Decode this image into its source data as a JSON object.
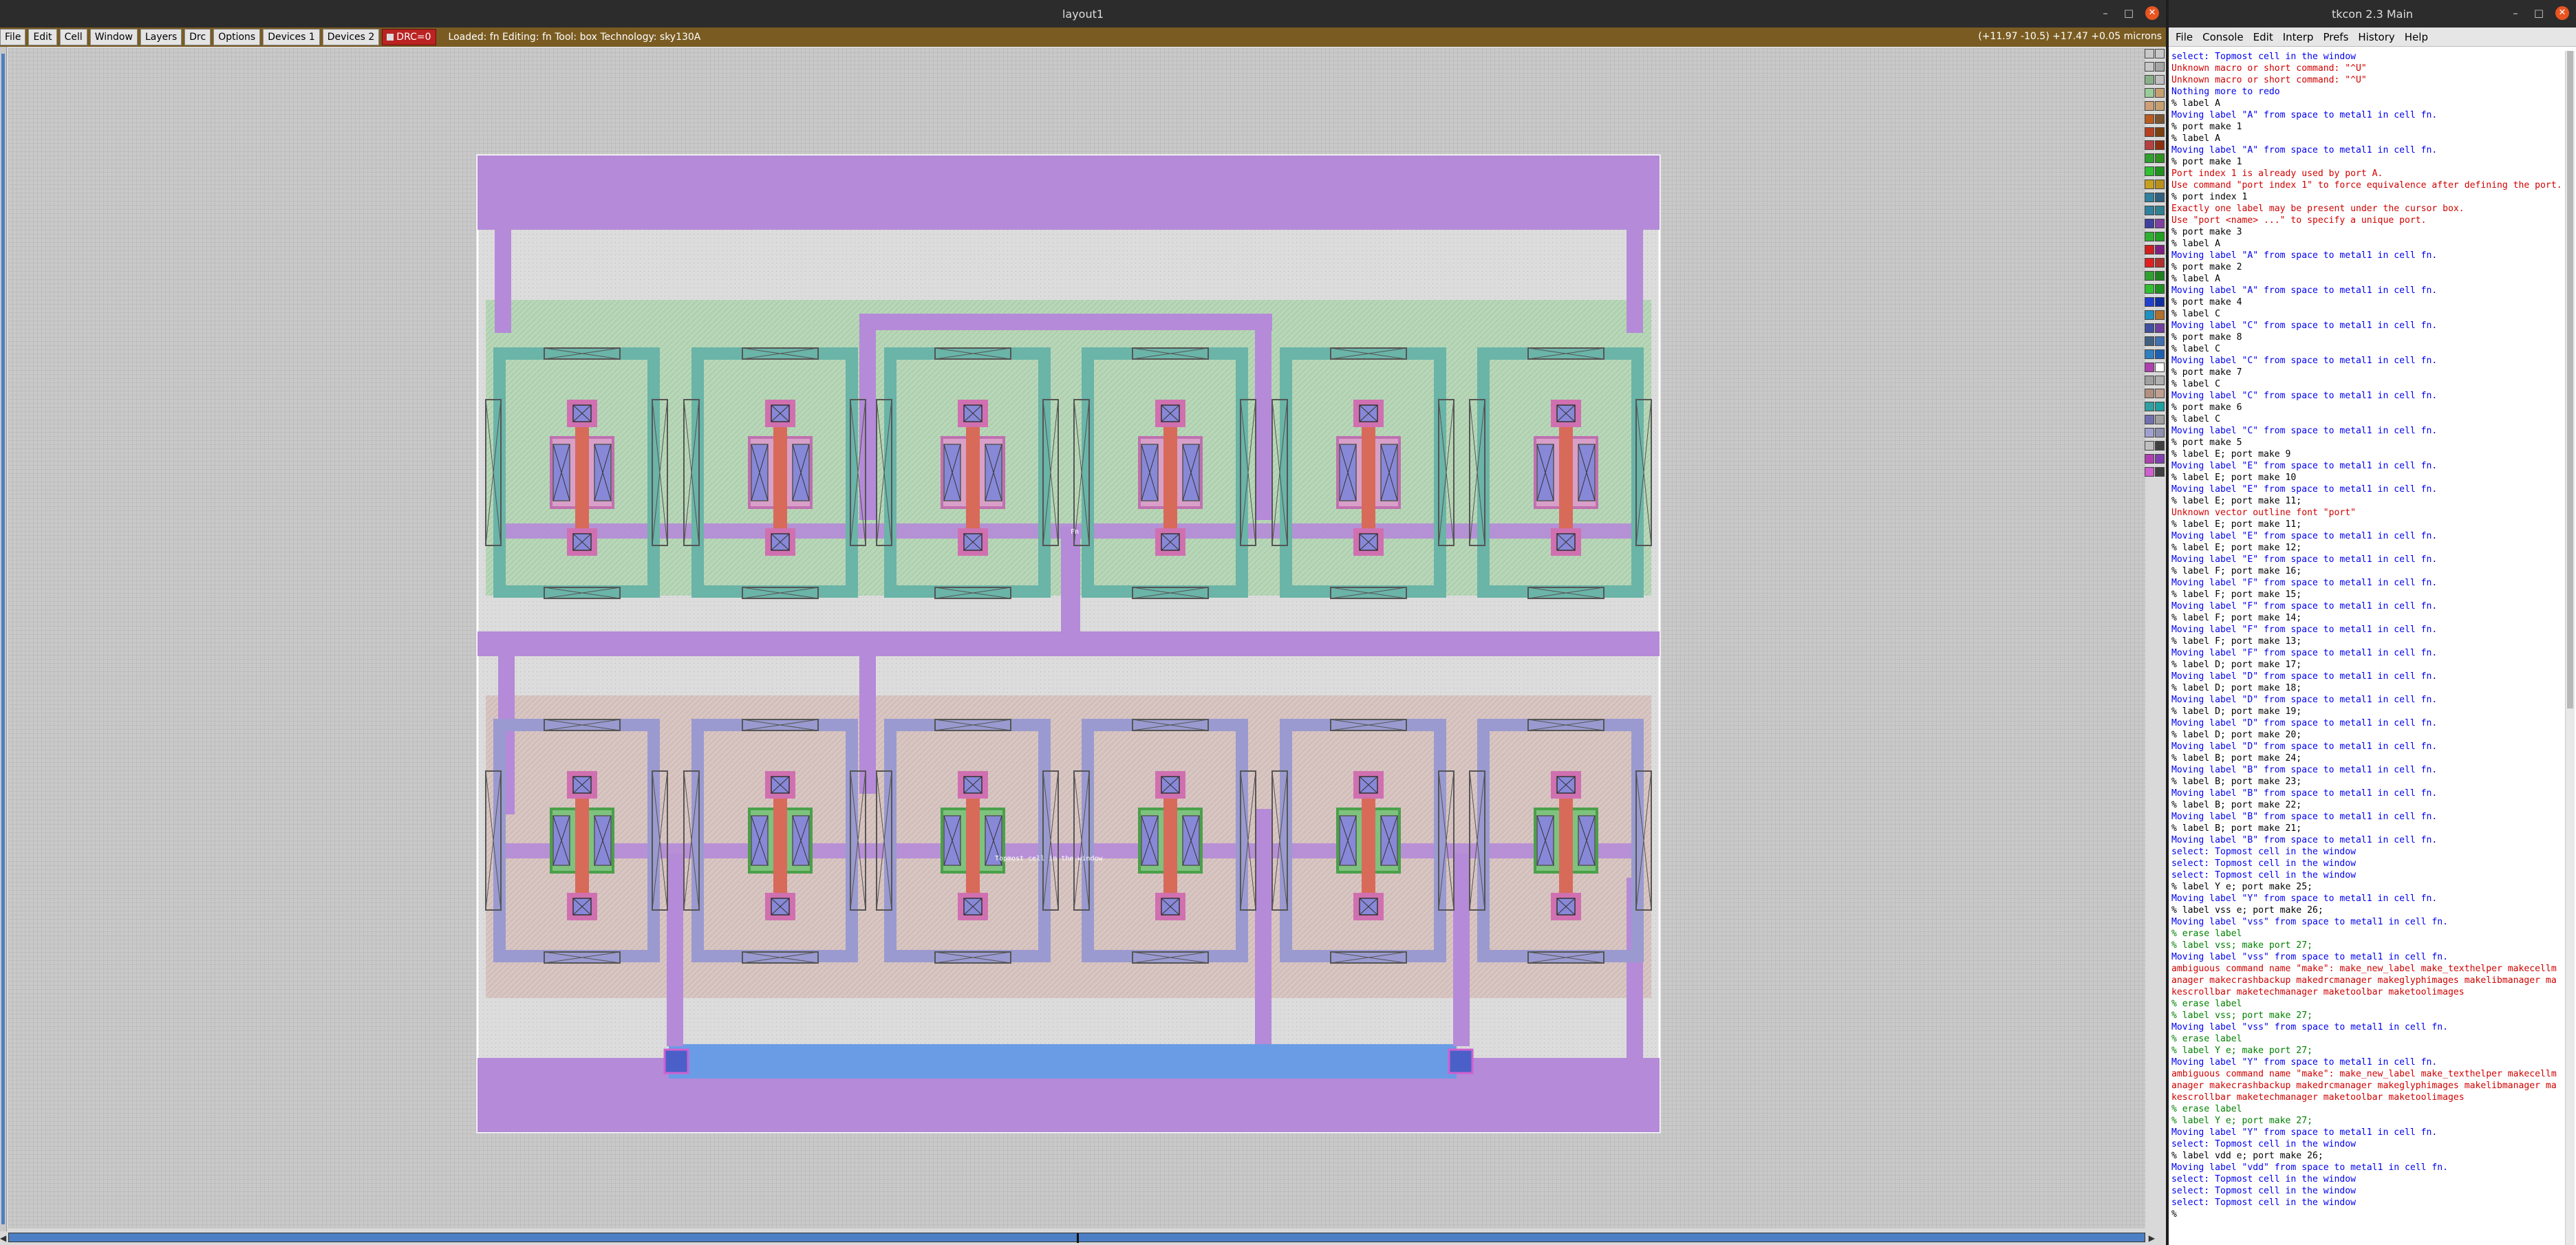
{
  "magic": {
    "title": "layout1",
    "menus": [
      "File",
      "Edit",
      "Cell",
      "Window",
      "Layers",
      "Drc",
      "Options",
      "Devices 1",
      "Devices 2"
    ],
    "drc_label": "DRC=0",
    "status": "Loaded: fn  Editing: fn  Tool: box   Technology: sky130A",
    "coords": "(+11.97 -10.5) +17.47 +0.05 microns",
    "cell_labels": {
      "upper": "Fn",
      "lower": "Topmost cell in the window"
    },
    "palette": [
      "#c8c8c8",
      "#c8c8c8",
      "#c8c8c8",
      "#a6a6a6",
      "#8ab08a",
      "#c0c0c0",
      "#9acc9a",
      "#c8a070",
      "#cfa078",
      "#c8a070",
      "#b85c20",
      "#7a5430",
      "#b84020",
      "#7a4010",
      "#b84040",
      "#8a3010",
      "#30a030",
      "#309020",
      "#30c030",
      "#209020",
      "#c8a020",
      "#b89020",
      "#3080a0",
      "#306080",
      "#3080a0",
      "#308090",
      "#4040a0",
      "#8040a0",
      "#30b030",
      "#20a020",
      "#d02020",
      "#802080",
      "#e02020",
      "#b03030",
      "#30a030",
      "#208020",
      "#30c030",
      "#209020",
      "#2040d0",
      "#1030a0",
      "#2090c0",
      "#b07030",
      "#4050a0",
      "#7040a0",
      "#406080",
      "#4070b0",
      "#3080c0",
      "#2060b0",
      "#b040b0",
      "#ffffff",
      "#a0a0a0",
      "#b0b0b0",
      "#b09080",
      "#c0a090",
      "#30a0a0",
      "#20a0a0",
      "#7070b0",
      "#a0a0a0",
      "#a0a0d0",
      "#9090b0",
      "#c0c0c0",
      "#404040",
      "#b040b0",
      "#8040b0",
      "#d060d0",
      "#404040"
    ]
  },
  "tkcon": {
    "title": "tkcon 2.3 Main",
    "menus": [
      "File",
      "Console",
      "Edit",
      "Interp",
      "Prefs",
      "History",
      "Help"
    ],
    "lines": [
      {
        "t": "select: Topmost cell in the window",
        "c": "b"
      },
      {
        "t": "Unknown macro or short command: \"^U\"",
        "c": "r"
      },
      {
        "t": "Unknown macro or short command: \"^U\"",
        "c": "r"
      },
      {
        "t": "Nothing more to redo",
        "c": "b"
      },
      {
        "t": "% label A",
        "c": "k"
      },
      {
        "t": "Moving label \"A\" from space to metal1 in cell fn.",
        "c": "b"
      },
      {
        "t": "% port make 1",
        "c": "k"
      },
      {
        "t": "% label A",
        "c": "k"
      },
      {
        "t": "Moving label \"A\" from space to metal1 in cell fn.",
        "c": "b"
      },
      {
        "t": "% port make 1",
        "c": "k"
      },
      {
        "t": "Port index 1 is already used by port A.",
        "c": "r"
      },
      {
        "t": "Use command \"port index 1\" to force equivalence after defining the port.",
        "c": "r"
      },
      {
        "t": "% port index 1",
        "c": "k"
      },
      {
        "t": "Exactly one label may be present under the cursor box.",
        "c": "r"
      },
      {
        "t": "Use \"port <name> ...\" to specify a unique port.",
        "c": "r"
      },
      {
        "t": "% port make 3",
        "c": "k"
      },
      {
        "t": "% label A",
        "c": "k"
      },
      {
        "t": "Moving label \"A\" from space to metal1 in cell fn.",
        "c": "b"
      },
      {
        "t": "% port make 2",
        "c": "k"
      },
      {
        "t": "% label A",
        "c": "k"
      },
      {
        "t": "Moving label \"A\" from space to metal1 in cell fn.",
        "c": "b"
      },
      {
        "t": "% port make 4",
        "c": "k"
      },
      {
        "t": "% label C",
        "c": "k"
      },
      {
        "t": "Moving label \"C\" from space to metal1 in cell fn.",
        "c": "b"
      },
      {
        "t": "% port make 8",
        "c": "k"
      },
      {
        "t": "% label C",
        "c": "k"
      },
      {
        "t": "Moving label \"C\" from space to metal1 in cell fn.",
        "c": "b"
      },
      {
        "t": "% port make 7",
        "c": "k"
      },
      {
        "t": "% label C",
        "c": "k"
      },
      {
        "t": "Moving label \"C\" from space to metal1 in cell fn.",
        "c": "b"
      },
      {
        "t": "% port make 6",
        "c": "k"
      },
      {
        "t": "% label C",
        "c": "k"
      },
      {
        "t": "Moving label \"C\" from space to metal1 in cell fn.",
        "c": "b"
      },
      {
        "t": "% port make 5",
        "c": "k"
      },
      {
        "t": "% label E; port make 9",
        "c": "k"
      },
      {
        "t": "Moving label \"E\" from space to metal1 in cell fn.",
        "c": "b"
      },
      {
        "t": "% label E; port make 10",
        "c": "k"
      },
      {
        "t": "Moving label \"E\" from space to metal1 in cell fn.",
        "c": "b"
      },
      {
        "t": "% label E; port make 11;",
        "c": "k"
      },
      {
        "t": "Unknown vector outline font \"port\"",
        "c": "r"
      },
      {
        "t": "% label E; port make 11;",
        "c": "k"
      },
      {
        "t": "Moving label \"E\" from space to metal1 in cell fn.",
        "c": "b"
      },
      {
        "t": "% label E; port make 12;",
        "c": "k"
      },
      {
        "t": "Moving label \"E\" from space to metal1 in cell fn.",
        "c": "b"
      },
      {
        "t": "% label F; port make 16;",
        "c": "k"
      },
      {
        "t": "Moving label \"F\" from space to metal1 in cell fn.",
        "c": "b"
      },
      {
        "t": "% label F; port make 15;",
        "c": "k"
      },
      {
        "t": "Moving label \"F\" from space to metal1 in cell fn.",
        "c": "b"
      },
      {
        "t": "% label F; port make 14;",
        "c": "k"
      },
      {
        "t": "Moving label \"F\" from space to metal1 in cell fn.",
        "c": "b"
      },
      {
        "t": "% label F; port make 13;",
        "c": "k"
      },
      {
        "t": "Moving label \"F\" from space to metal1 in cell fn.",
        "c": "b"
      },
      {
        "t": "% label D; port make 17;",
        "c": "k"
      },
      {
        "t": "Moving label \"D\" from space to metal1 in cell fn.",
        "c": "b"
      },
      {
        "t": "% label D; port make 18;",
        "c": "k"
      },
      {
        "t": "Moving label \"D\" from space to metal1 in cell fn.",
        "c": "b"
      },
      {
        "t": "% label D; port make 19;",
        "c": "k"
      },
      {
        "t": "Moving label \"D\" from space to metal1 in cell fn.",
        "c": "b"
      },
      {
        "t": "% label D; port make 20;",
        "c": "k"
      },
      {
        "t": "Moving label \"D\" from space to metal1 in cell fn.",
        "c": "b"
      },
      {
        "t": "% label B; port make 24;",
        "c": "k"
      },
      {
        "t": "Moving label \"B\" from space to metal1 in cell fn.",
        "c": "b"
      },
      {
        "t": "% label B; port make 23;",
        "c": "k"
      },
      {
        "t": "Moving label \"B\" from space to metal1 in cell fn.",
        "c": "b"
      },
      {
        "t": "% label B; port make 22;",
        "c": "k"
      },
      {
        "t": "Moving label \"B\" from space to metal1 in cell fn.",
        "c": "b"
      },
      {
        "t": "% label B; port make 21;",
        "c": "k"
      },
      {
        "t": "Moving label \"B\" from space to metal1 in cell fn.",
        "c": "b"
      },
      {
        "t": "select: Topmost cell in the window",
        "c": "b"
      },
      {
        "t": "select: Topmost cell in the window",
        "c": "b"
      },
      {
        "t": "select: Topmost cell in the window",
        "c": "b"
      },
      {
        "t": "% label Y e; port make 25;",
        "c": "k"
      },
      {
        "t": "Moving label \"Y\" from space to metal1 in cell fn.",
        "c": "b"
      },
      {
        "t": "% label vss e; port make 26;",
        "c": "k"
      },
      {
        "t": "Moving label \"vss\" from space to metal1 in cell fn.",
        "c": "b"
      },
      {
        "t": "% erase label",
        "c": "g"
      },
      {
        "t": "% label vss; make port 27;",
        "c": "g"
      },
      {
        "t": "Moving label \"vss\" from space to metal1 in cell fn.",
        "c": "b"
      },
      {
        "t": "ambiguous command name \"make\": make_new_label make_texthelper makecellm",
        "c": "r"
      },
      {
        "t": "anager makecrashbackup makedrcmanager makeglyphimages makelibmanager ma",
        "c": "r"
      },
      {
        "t": "kescrollbar maketechmanager maketoolbar maketoolimages",
        "c": "r"
      },
      {
        "t": "% erase label",
        "c": "g"
      },
      {
        "t": "% label vss; port make 27;",
        "c": "g"
      },
      {
        "t": "Moving label \"vss\" from space to metal1 in cell fn.",
        "c": "b"
      },
      {
        "t": "% erase label",
        "c": "g"
      },
      {
        "t": "% label Y e; make port 27;",
        "c": "g"
      },
      {
        "t": "Moving label \"Y\" from space to metal1 in cell fn.",
        "c": "b"
      },
      {
        "t": "ambiguous command name \"make\": make_new_label make_texthelper makecellm",
        "c": "r"
      },
      {
        "t": "anager makecrashbackup makedrcmanager makeglyphimages makelibmanager ma",
        "c": "r"
      },
      {
        "t": "kescrollbar maketechmanager maketoolbar maketoolimages",
        "c": "r"
      },
      {
        "t": "% erase label",
        "c": "g"
      },
      {
        "t": "% label Y e; port make 27;",
        "c": "g"
      },
      {
        "t": "Moving label \"Y\" from space to metal1 in cell fn.",
        "c": "b"
      },
      {
        "t": "select: Topmost cell in the window",
        "c": "b"
      },
      {
        "t": "% label vdd e; port make 26;",
        "c": "k"
      },
      {
        "t": "Moving label \"vdd\" from space to metal1 in cell fn.",
        "c": "b"
      },
      {
        "t": "select: Topmost cell in the window",
        "c": "b"
      },
      {
        "t": "select: Topmost cell in the window",
        "c": "b"
      },
      {
        "t": "select: Topmost cell in the window",
        "c": "b"
      },
      {
        "t": "%",
        "c": "k"
      }
    ]
  }
}
